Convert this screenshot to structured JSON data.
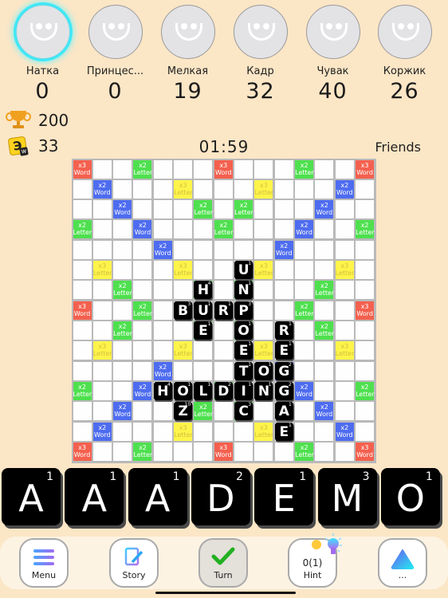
{
  "players": [
    {
      "name": "Натка",
      "score": "0",
      "active": true
    },
    {
      "name": "Принцес...",
      "score": "0",
      "active": false
    },
    {
      "name": "Мелкая",
      "score": "19",
      "active": false
    },
    {
      "name": "Кадр",
      "score": "32",
      "active": false
    },
    {
      "name": "Чувак",
      "score": "40",
      "active": false
    },
    {
      "name": "Коржик",
      "score": "26",
      "active": false
    }
  ],
  "stats": {
    "trophy_icon": "trophy-icon",
    "trophies": "200",
    "letter_tile_icon": "letter-tile-icon",
    "letter_tile_glyph": "Э",
    "letters_left": "33"
  },
  "timer": "01:59",
  "game_mode": "Friends",
  "board": {
    "size": 15,
    "premium_labels": {
      "tw": [
        "x3",
        "Word"
      ],
      "dw": [
        "x2",
        "Word"
      ],
      "tl": [
        "x3",
        "Letter"
      ],
      "dl": [
        "x2",
        "Letter"
      ]
    },
    "premium_colors": {
      "tw": "#f4604e",
      "dw": "#4e6cf0",
      "tl": "#fff44a",
      "dl": "#4ee04e"
    },
    "premium_rows": [
      "T..d...T...d..T",
      ".D...t...t...D.",
      "..D...d.d...D..",
      "d..D...d...D..d",
      "....D.....D....",
      ".t...t...t...t.",
      "..d...d.d...d..",
      "T..d.......d..T",
      "..d...d.d...d..",
      ".t...t...t...t.",
      "....D.....D....",
      "d..D...d...D..d",
      "..D...d.d...D..",
      ".D...t...t...D.",
      "T..d...T...d..T"
    ],
    "tiles": [
      {
        "r": 5,
        "c": 8,
        "letter": "U",
        "score": "1"
      },
      {
        "r": 6,
        "c": 8,
        "letter": "N",
        "score": "1"
      },
      {
        "r": 7,
        "c": 8,
        "letter": "P",
        "score": "3"
      },
      {
        "r": 8,
        "c": 8,
        "letter": "O",
        "score": "1"
      },
      {
        "r": 9,
        "c": 8,
        "letter": "E",
        "score": "1"
      },
      {
        "r": 10,
        "c": 8,
        "letter": "T",
        "score": "1"
      },
      {
        "r": 11,
        "c": 8,
        "letter": "I",
        "score": "1"
      },
      {
        "r": 12,
        "c": 8,
        "letter": "C",
        "score": "3"
      },
      {
        "r": 6,
        "c": 6,
        "letter": "H",
        "score": "4"
      },
      {
        "r": 7,
        "c": 6,
        "letter": "U",
        "score": "1"
      },
      {
        "r": 8,
        "c": 6,
        "letter": "E",
        "score": "1"
      },
      {
        "r": 7,
        "c": 5,
        "letter": "B",
        "score": "3"
      },
      {
        "r": 7,
        "c": 7,
        "letter": "R",
        "score": "1"
      },
      {
        "r": 8,
        "c": 10,
        "letter": "R",
        "score": "1"
      },
      {
        "r": 9,
        "c": 10,
        "letter": "E",
        "score": "1"
      },
      {
        "r": 10,
        "c": 10,
        "letter": "G",
        "score": "2"
      },
      {
        "r": 11,
        "c": 10,
        "letter": "G",
        "score": "2"
      },
      {
        "r": 12,
        "c": 10,
        "letter": "A",
        "score": "1"
      },
      {
        "r": 13,
        "c": 10,
        "letter": "E",
        "score": "1"
      },
      {
        "r": 10,
        "c": 9,
        "letter": "O",
        "score": "1"
      },
      {
        "r": 11,
        "c": 4,
        "letter": "H",
        "score": "4"
      },
      {
        "r": 11,
        "c": 5,
        "letter": "O",
        "score": "1"
      },
      {
        "r": 11,
        "c": 6,
        "letter": "L",
        "score": "1"
      },
      {
        "r": 11,
        "c": 7,
        "letter": "D",
        "score": "2"
      },
      {
        "r": 11,
        "c": 9,
        "letter": "N",
        "score": "1"
      },
      {
        "r": 12,
        "c": 5,
        "letter": "Z",
        "score": "10"
      }
    ]
  },
  "rack": [
    {
      "letter": "A",
      "score": "1"
    },
    {
      "letter": "A",
      "score": "1"
    },
    {
      "letter": "A",
      "score": "1"
    },
    {
      "letter": "D",
      "score": "2"
    },
    {
      "letter": "E",
      "score": "1"
    },
    {
      "letter": "M",
      "score": "3"
    },
    {
      "letter": "O",
      "score": "1"
    }
  ],
  "toolbar": {
    "menu_label": "Menu",
    "story_label": "Story",
    "turn_label": "Turn",
    "hint_count": "0(1)",
    "hint_label": "Hint",
    "more_label": "..."
  }
}
